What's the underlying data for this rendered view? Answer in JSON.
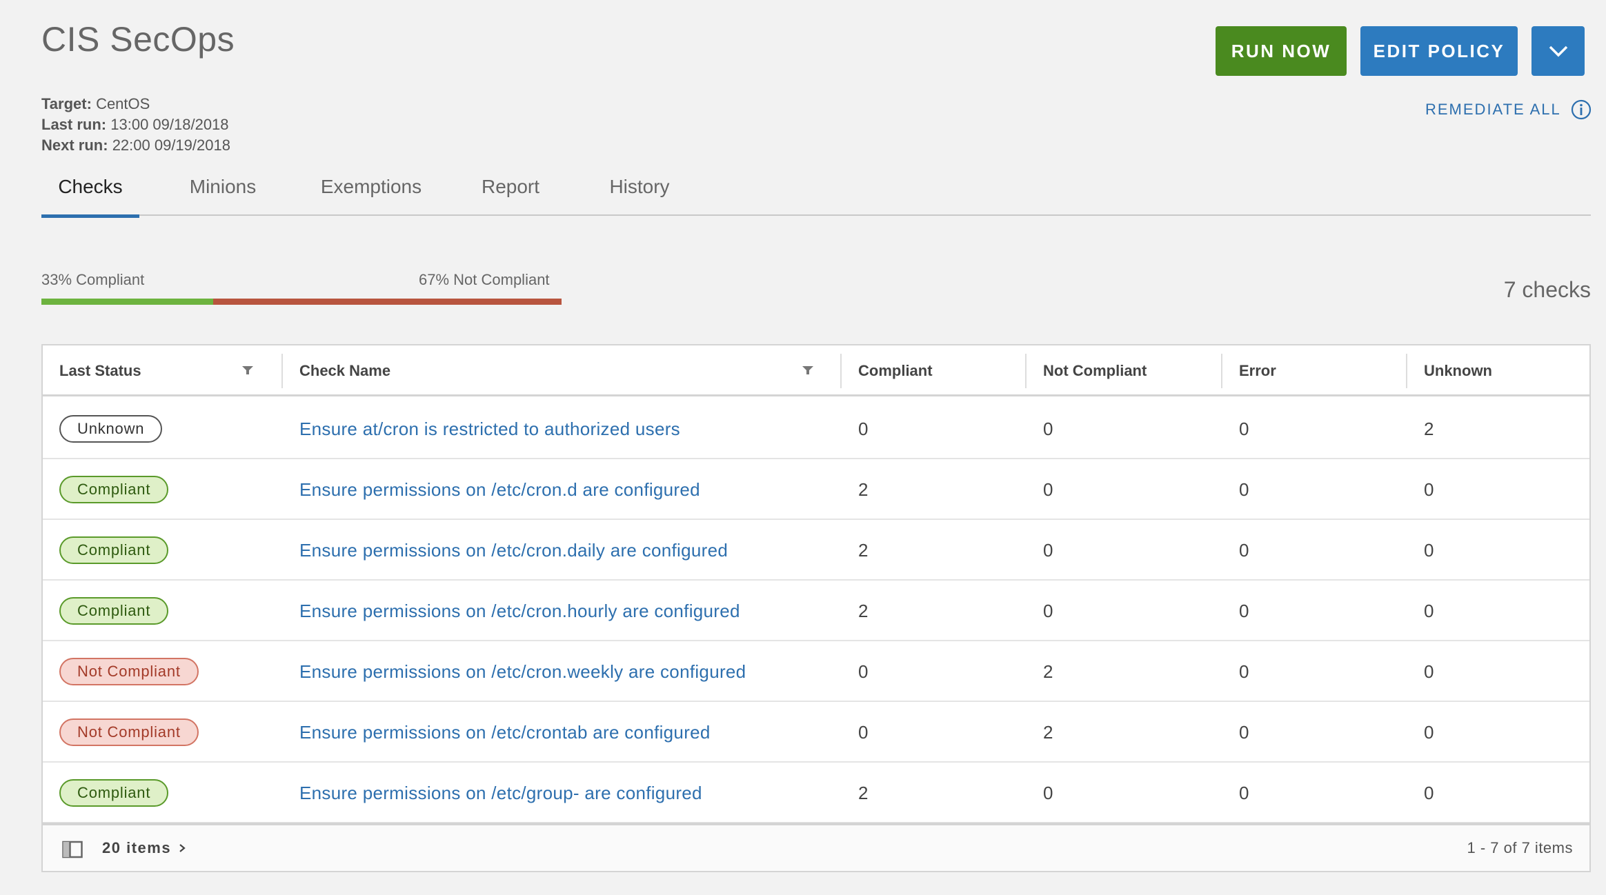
{
  "header": {
    "title": "CIS SecOps",
    "meta": [
      {
        "label": "Target:",
        "value": "CentOS"
      },
      {
        "label": "Last run:",
        "value": "13:00 09/18/2018"
      },
      {
        "label": "Next run:",
        "value": "22:00 09/19/2018"
      }
    ],
    "run_label": "RUN NOW",
    "edit_label": "EDIT POLICY",
    "remediate_label": "REMEDIATE ALL"
  },
  "tabs": [
    {
      "label": "Checks",
      "active": true
    },
    {
      "label": "Minions",
      "active": false
    },
    {
      "label": "Exemptions",
      "active": false
    },
    {
      "label": "Report",
      "active": false
    },
    {
      "label": "History",
      "active": false
    }
  ],
  "summary": {
    "compliant_label": "33% Compliant",
    "not_compliant_label": "67% Not Compliant",
    "compliant_fraction": 0.33,
    "checks_label": "7 checks"
  },
  "table": {
    "columns": [
      "Last Status",
      "Check Name",
      "Compliant",
      "Not Compliant",
      "Error",
      "Unknown"
    ],
    "rows": [
      {
        "status": "Unknown",
        "kind": "unknown",
        "name": "Ensure at/cron is restricted to authorized users",
        "compliant": "0",
        "not_compliant": "0",
        "error": "0",
        "unknown": "2"
      },
      {
        "status": "Compliant",
        "kind": "compliant",
        "name": "Ensure permissions on /etc/cron.d are configured",
        "compliant": "2",
        "not_compliant": "0",
        "error": "0",
        "unknown": "0"
      },
      {
        "status": "Compliant",
        "kind": "compliant",
        "name": "Ensure permissions on /etc/cron.daily are configured",
        "compliant": "2",
        "not_compliant": "0",
        "error": "0",
        "unknown": "0"
      },
      {
        "status": "Compliant",
        "kind": "compliant",
        "name": "Ensure permissions on /etc/cron.hourly are configured",
        "compliant": "2",
        "not_compliant": "0",
        "error": "0",
        "unknown": "0"
      },
      {
        "status": "Not Compliant",
        "kind": "notcompliant",
        "name": "Ensure permissions on /etc/cron.weekly are configured",
        "compliant": "0",
        "not_compliant": "2",
        "error": "0",
        "unknown": "0"
      },
      {
        "status": "Not Compliant",
        "kind": "notcompliant",
        "name": "Ensure permissions on /etc/crontab are configured",
        "compliant": "0",
        "not_compliant": "2",
        "error": "0",
        "unknown": "0"
      },
      {
        "status": "Compliant",
        "kind": "compliant",
        "name": "Ensure permissions on /etc/group- are configured",
        "compliant": "2",
        "not_compliant": "0",
        "error": "0",
        "unknown": "0"
      }
    ],
    "footer": {
      "items_label": "20 items",
      "pager_text": "1 - 7 of 7 items"
    }
  },
  "colors": {
    "run_button": "#4a8a1f",
    "primary_button": "#2d7bbf",
    "link": "#2d6fae",
    "compliant_bar": "#6db33f",
    "not_compliant_bar": "#b8553f"
  },
  "icons": {
    "dropdown": "chevron-down-icon",
    "remediate_info": "info-icon",
    "column_filter": "filter-icon",
    "column_toggle": "columns-icon",
    "items_chevron": "chevron-right-icon"
  }
}
